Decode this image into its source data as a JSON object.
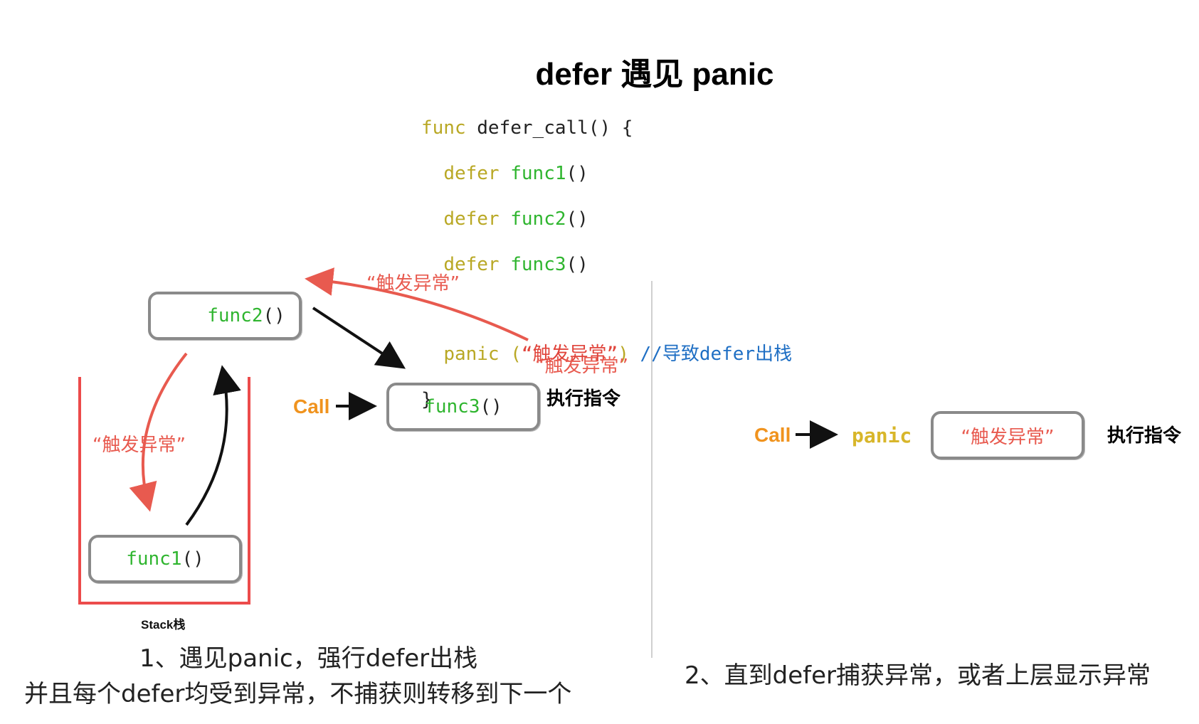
{
  "title": "defer 遇见 panic",
  "code": {
    "line1_kw": "func",
    "line1_rest": " defer_call() {",
    "line2_kw": "defer",
    "line2_fn": "func1",
    "line3_kw": "defer",
    "line3_fn": "func2",
    "line4_kw": "defer",
    "line4_fn": "func3",
    "paren": "()",
    "panic_kw": "panic",
    "panic_open": " (",
    "panic_str": "“触发异常”",
    "panic_close": ")",
    "comment": " //导致defer出栈",
    "close_brace": "}"
  },
  "left": {
    "func2": "func2",
    "func3": "func3",
    "func1": "func1",
    "paren": "()",
    "label_top": "“触发异常”",
    "label_right": "“触发异常”",
    "label_left": "“触发异常”",
    "call": "Call",
    "exec": "执行指令",
    "stack_label": "Stack栈",
    "caption_line1": "1、遇见panic，强行defer出栈",
    "caption_line2": "并且每个defer均受到异常，不捕获则转移到下一个"
  },
  "right": {
    "call": "Call",
    "panic": "panic",
    "box_text": "“触发异常”",
    "exec": "执行指令",
    "caption": "2、直到defer捕获异常，或者上层显示异常"
  },
  "colors": {
    "keyword": "#b9a825",
    "function": "#2fb52f",
    "string": "#e0443b",
    "comment": "#1f6fc4",
    "call": "#f0931e",
    "stack": "#ec4b4b",
    "arrow_red": "#e85a4f",
    "box_border": "#8a8a8a"
  }
}
